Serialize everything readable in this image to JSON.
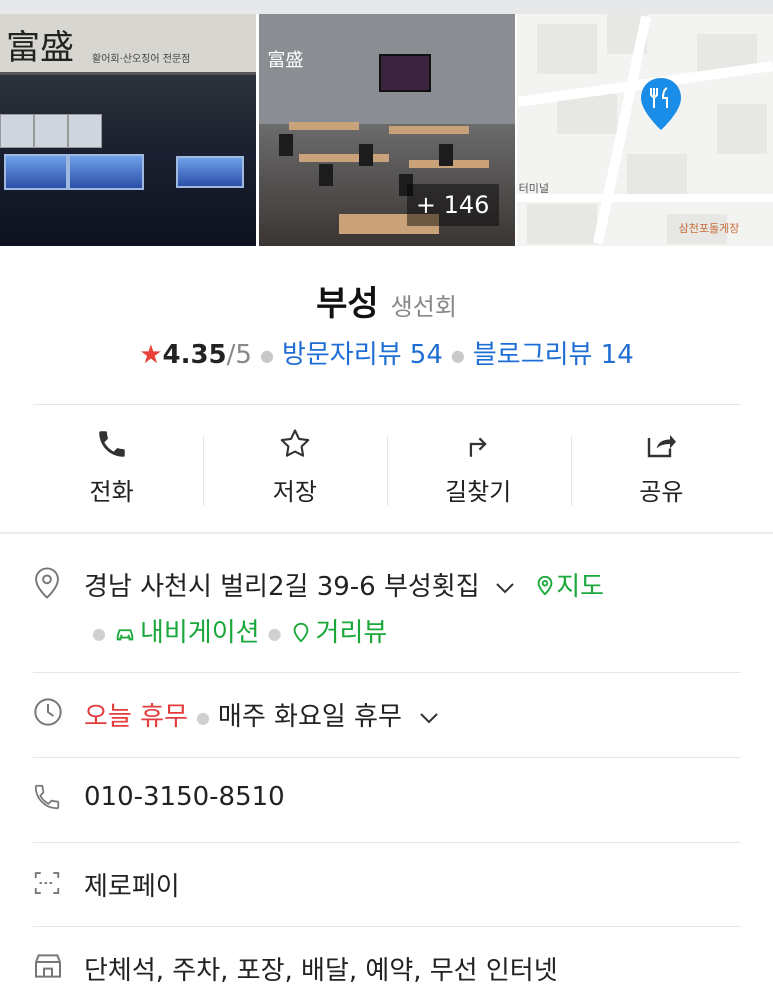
{
  "photos": {
    "sign_big": "富盛",
    "sign_small": "활어회·산오징어 전문점",
    "interior_sign": "富盛",
    "more_count": "+ 146",
    "map_label_1": "터미널",
    "map_label_2": "삼천포돌게장"
  },
  "place": {
    "name": "부성",
    "category": "생선회"
  },
  "rating": {
    "star": "★",
    "score": "4.35",
    "out_of": "/5",
    "visitor_reviews": "방문자리뷰 54",
    "blog_reviews": "블로그리뷰 14"
  },
  "actions": [
    {
      "label": "전화",
      "icon": "phone-icon"
    },
    {
      "label": "저장",
      "icon": "star-outline-icon"
    },
    {
      "label": "길찾기",
      "icon": "directions-icon"
    },
    {
      "label": "공유",
      "icon": "share-icon"
    }
  ],
  "address": {
    "text": "경남 사천시 벌리2길 39-6 부성횟집",
    "map_link": "지도",
    "navigation_link": "내비게이션",
    "street_view_link": "거리뷰"
  },
  "hours": {
    "status": "오늘 휴무",
    "detail": "매주 화요일 휴무"
  },
  "phone": "010-3150-8510",
  "payment": "제로페이",
  "amenities": "단체석, 주차, 포장, 배달, 예약, 무선 인터넷",
  "colors": {
    "green": "#1aa83b",
    "blue": "#1f6ed4",
    "red": "#e33c3c",
    "star": "#e94339"
  }
}
